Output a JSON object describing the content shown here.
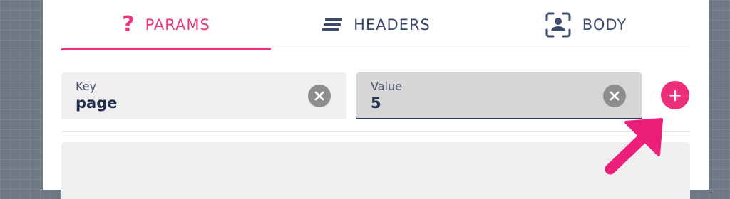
{
  "tabs": [
    {
      "label": "PARAMS",
      "icon": "question-icon",
      "active": true
    },
    {
      "label": "HEADERS",
      "icon": "lines-icon",
      "active": false
    },
    {
      "label": "BODY",
      "icon": "user-frame-icon",
      "active": false
    }
  ],
  "key_field": {
    "label": "Key",
    "value": "page"
  },
  "value_field": {
    "label": "Value",
    "value": "5"
  },
  "add_button": {
    "label": "+"
  },
  "colors": {
    "accent": "#e8357d",
    "text": "#3b4a6b",
    "field_bg": "#efefef",
    "field_active_bg": "#d6d6d6",
    "clear_icon": "#8d8d8d",
    "pointer_arrow": "#ec1f7a"
  }
}
